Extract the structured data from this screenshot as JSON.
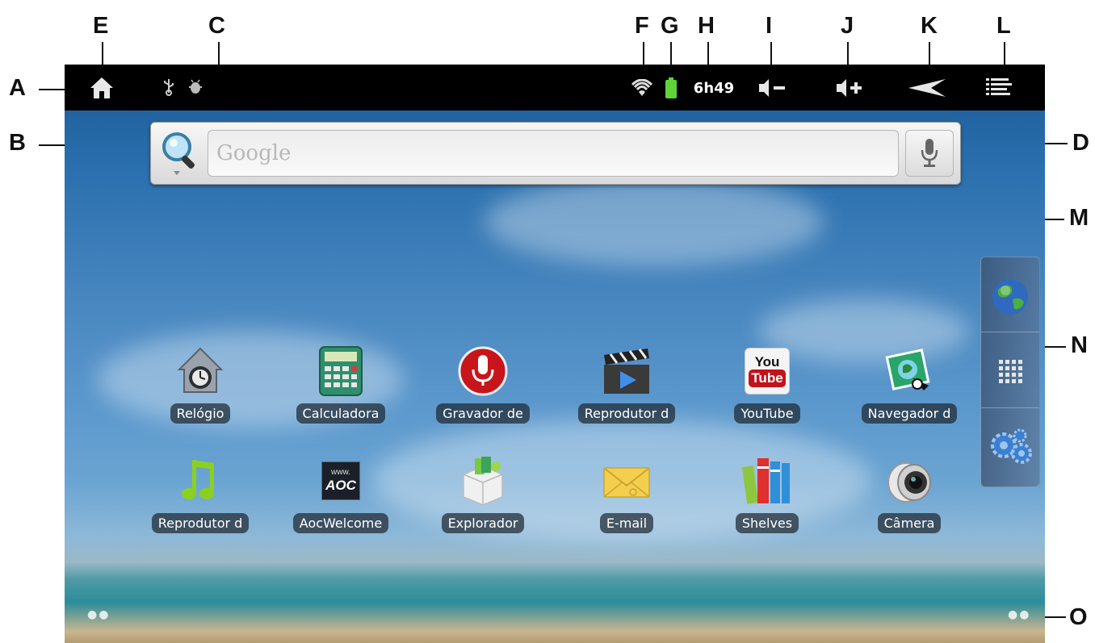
{
  "callouts": {
    "A": "A",
    "B": "B",
    "C": "C",
    "D": "D",
    "E": "E",
    "F": "F",
    "G": "G",
    "H": "H",
    "I": "I",
    "J": "J",
    "K": "K",
    "L": "L",
    "M": "M",
    "N": "N",
    "O": "O"
  },
  "statusbar": {
    "icons": [
      "home-icon",
      "usb-icon",
      "android-debug-icon",
      "wifi-icon",
      "battery-icon",
      "volume-down-icon",
      "volume-up-icon",
      "back-icon",
      "menu-icon"
    ],
    "time": "6h49",
    "battery_color": "#5fd33a"
  },
  "search": {
    "placeholder": "Google",
    "icons": [
      "search-icon",
      "microphone-icon"
    ]
  },
  "apps": [
    {
      "label": "Relógio",
      "icon": "clock-icon"
    },
    {
      "label": "Calculadora",
      "icon": "calculator-icon"
    },
    {
      "label": "Gravador de",
      "icon": "voice-recorder-icon"
    },
    {
      "label": "Reprodutor d",
      "icon": "video-player-icon"
    },
    {
      "label": "YouTube",
      "icon": "youtube-icon"
    },
    {
      "label": "Navegador d",
      "icon": "browser-icon"
    },
    {
      "label": "Reprodutor d",
      "icon": "music-player-icon"
    },
    {
      "label": "AocWelcome",
      "icon": "aoc-icon"
    },
    {
      "label": "Explorador",
      "icon": "file-explorer-icon"
    },
    {
      "label": "E-mail",
      "icon": "email-icon"
    },
    {
      "label": "Shelves",
      "icon": "books-icon"
    },
    {
      "label": "Câmera",
      "icon": "camera-icon"
    }
  ],
  "youtube_logo": {
    "top": "You",
    "bottom": "Tube"
  },
  "aoc_logo": {
    "top": "www.",
    "bottom": "AOC"
  },
  "dock": {
    "items": [
      "globe-icon",
      "app-grid-icon",
      "settings-gears-icon"
    ]
  },
  "page_indicators": {
    "left": "●●",
    "right": "●●"
  }
}
